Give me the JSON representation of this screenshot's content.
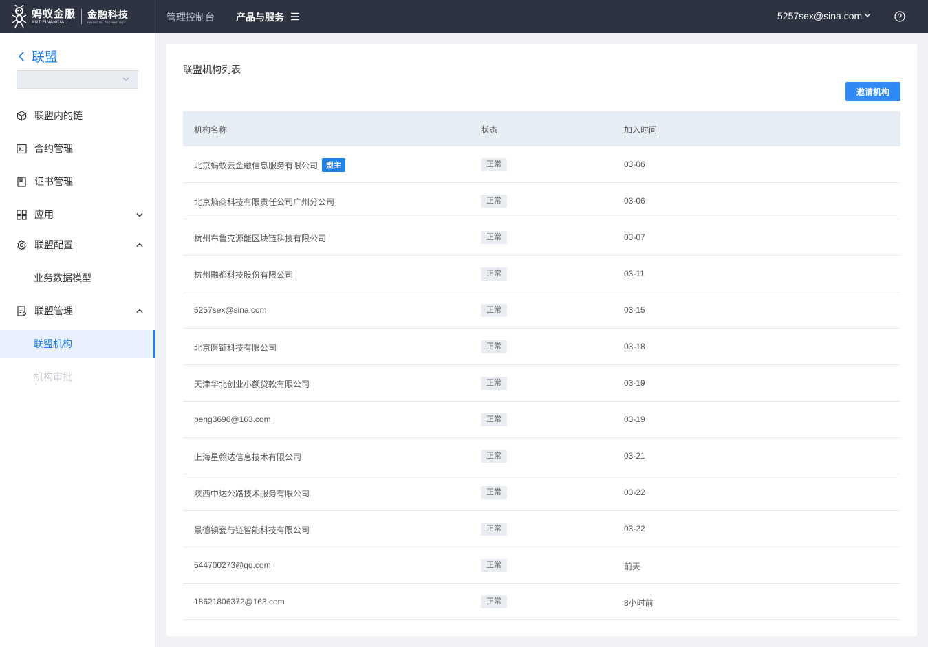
{
  "header": {
    "logo": {
      "cn": "蚂蚁金服",
      "en": "ANT FINANCIAL",
      "fin_cn": "金融科技",
      "fin_en": "FINANCIAL TECHNOLOGY"
    },
    "nav_console": "管理控制台",
    "nav_products": "产品与服务",
    "user": "5257sex@sina.com"
  },
  "sidebar": {
    "back_label": "联盟",
    "select_value": "",
    "items": [
      {
        "label": "联盟内的链"
      },
      {
        "label": "合约管理"
      },
      {
        "label": "证书管理"
      },
      {
        "label": "应用"
      },
      {
        "label": "联盟配置"
      },
      {
        "label": "业务数据模型"
      },
      {
        "label": "联盟管理"
      },
      {
        "label": "联盟机构"
      },
      {
        "label": "机构审批"
      }
    ]
  },
  "main": {
    "title": "联盟机构列表",
    "invite_label": "邀请机构",
    "columns": [
      "机构名称",
      "状态",
      "加入时间"
    ],
    "owner_badge": "盟主",
    "rows": [
      {
        "name": "北京蚂蚁云金融信息服务有限公司",
        "status": "正常",
        "date": "03-06"
      },
      {
        "name": "北京熵商科技有限责任公司广州分公司",
        "status": "正常",
        "date": "03-06"
      },
      {
        "name": "杭州布鲁克源能区块链科技有限公司",
        "status": "正常",
        "date": "03-07"
      },
      {
        "name": "杭州融都科技股份有限公司",
        "status": "正常",
        "date": "03-11"
      },
      {
        "name": "5257sex@sina.com",
        "status": "正常",
        "date": "03-15"
      },
      {
        "name": "北京医链科技有限公司",
        "status": "正常",
        "date": "03-18"
      },
      {
        "name": "天津华北创业小额贷款有限公司",
        "status": "正常",
        "date": "03-19"
      },
      {
        "name": "peng3696@163.com",
        "status": "正常",
        "date": "03-19"
      },
      {
        "name": "上海星翰达信息技术有限公司",
        "status": "正常",
        "date": "03-21"
      },
      {
        "name": "陕西中达公路技术服务有限公司",
        "status": "正常",
        "date": "03-22"
      },
      {
        "name": "景德镇瓷与链智能科技有限公司",
        "status": "正常",
        "date": "03-22"
      },
      {
        "name": "544700273@qq.com",
        "status": "正常",
        "date": "前天"
      },
      {
        "name": "18621806372@163.com",
        "status": "正常",
        "date": "8小时前"
      }
    ]
  },
  "colors": {
    "topbar": "#2d3341",
    "accent": "#1f7ee8",
    "button": "#2f8af5"
  }
}
